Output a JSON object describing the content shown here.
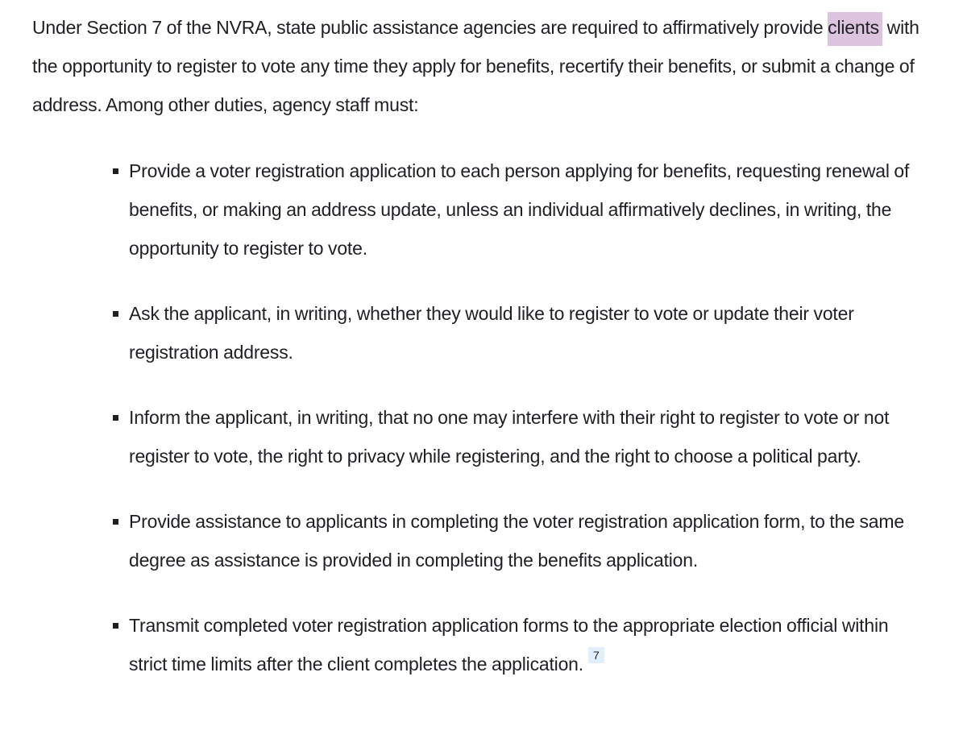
{
  "intro": {
    "before": "Under Section 7 of the NVRA, state public assistance agencies are required to affirmatively provide ",
    "highlighted": "clients",
    "after": " with the opportunity to register to vote any time they apply for benefits, recertify their benefits, or submit a change of address. Among other duties, agency staff must:"
  },
  "highlight_color": "#dcc4de",
  "duties": [
    {
      "text": "Provide a voter registration application to each person applying for benefits, requesting renewal of benefits, or making an address update, unless an individual affirmatively declines, in writing, the opportunity to register to vote."
    },
    {
      "text": "Ask the applicant, in writing, whether they would like to register to vote or update their voter registration address."
    },
    {
      "text": "Inform the applicant, in writing, that no one may interfere with their right to register to vote or not register to vote, the right to privacy while registering, and the right to choose a political party."
    },
    {
      "text": "Provide assistance to applicants in completing the voter registration application form, to the same degree as assistance is provided in completing the benefits application."
    },
    {
      "text": "Transmit completed voter registration application forms to the appropriate election official within strict time limits after the client completes the application.",
      "footnote": "7"
    }
  ]
}
